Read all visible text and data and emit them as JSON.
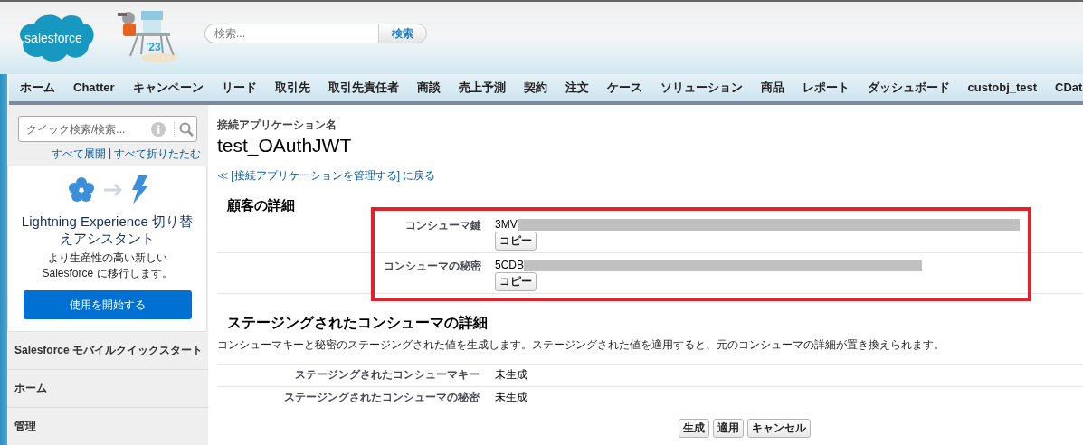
{
  "header": {
    "logo": "salesforce",
    "mascot_badge": "’23",
    "search": {
      "placeholder": "検索...",
      "button": "検索"
    }
  },
  "tabs": [
    {
      "label": "ホーム",
      "selected": false
    },
    {
      "label": "Chatter",
      "selected": false
    },
    {
      "label": "キャンペーン",
      "selected": false
    },
    {
      "label": "リード",
      "selected": false
    },
    {
      "label": "取引先",
      "selected": false
    },
    {
      "label": "取引先責任者",
      "selected": false
    },
    {
      "label": "商談",
      "selected": false
    },
    {
      "label": "売上予測",
      "selected": false
    },
    {
      "label": "契約",
      "selected": false
    },
    {
      "label": "注文",
      "selected": false
    },
    {
      "label": "ケース",
      "selected": false
    },
    {
      "label": "ソリューション",
      "selected": false
    },
    {
      "label": "商品",
      "selected": false
    },
    {
      "label": "レポート",
      "selected": false
    },
    {
      "label": "ダッシュボード",
      "selected": false
    },
    {
      "label": "custobj_test",
      "selected": false
    },
    {
      "label": "CDat",
      "selected": false
    }
  ],
  "sidebar": {
    "search": {
      "placeholder": "クイック検索/検索..."
    },
    "links": [
      "すべて展開",
      "すべて折りたたむ"
    ],
    "link_separator": "|",
    "promo": {
      "title": "Lightning Experience 切り替えアシスタント",
      "description": "より生産性の高い新しい Salesforce に移行します。",
      "button": "使用を開始する"
    },
    "sections": [
      "Salesforce モバイルクイックスタート",
      "ホーム",
      "管理"
    ]
  },
  "main": {
    "label": "接続アプリケーション名",
    "title": "test_OAuthJWT",
    "back_link": "≪ [接続アプリケーションを管理する] に戻る",
    "customer_details": {
      "heading": "顧客の詳細",
      "highlighted": true,
      "fields": [
        {
          "label": "コンシューマ鍵",
          "value": "3MV",
          "redacted": true,
          "button": "コピー"
        },
        {
          "label": "コンシューマの秘密",
          "value": "5CDB",
          "redacted": true,
          "button": "コピー"
        }
      ]
    },
    "staged_details": {
      "heading": "ステージングされたコンシューマの詳細",
      "description": "コンシューマキーと秘密のステージングされた値を生成します。ステージングされた値を適用すると、元のコンシューマの詳細が置き換えられます。",
      "fields": [
        {
          "label": "ステージングされたコンシューマキー",
          "value": "未生成"
        },
        {
          "label": "ステージングされたコンシューマの秘密",
          "value": "未生成"
        }
      ],
      "buttons": [
        "生成",
        "適用",
        "キャンセル"
      ]
    }
  }
}
